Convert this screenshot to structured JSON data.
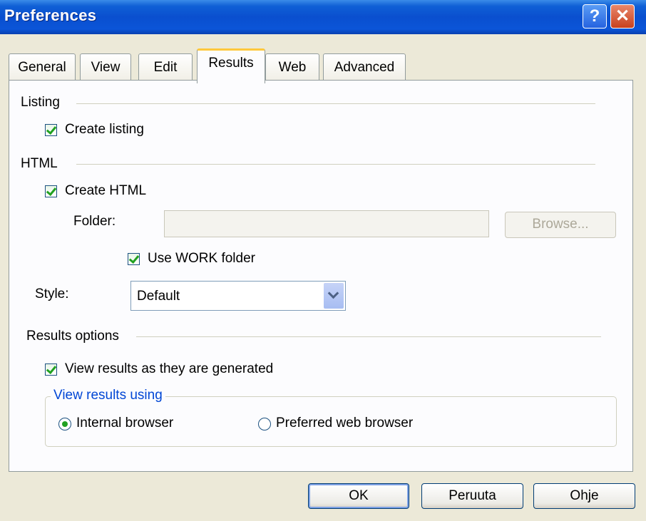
{
  "window": {
    "title": "Preferences"
  },
  "tabs": [
    "General",
    "View",
    "Edit",
    "Results",
    "Web",
    "Advanced"
  ],
  "active_tab": "Results",
  "listing": {
    "section": "Listing",
    "create_listing": {
      "label": "Create listing",
      "checked": true
    }
  },
  "html": {
    "section": "HTML",
    "create_html": {
      "label": "Create HTML",
      "checked": true
    },
    "folder_label": "Folder:",
    "folder_value": "",
    "browse_label": "Browse...",
    "use_work": {
      "label": "Use WORK folder",
      "checked": true
    },
    "style_label": "Style:",
    "style_value": "Default"
  },
  "results_options": {
    "section": "Results options",
    "view_results": {
      "label": "View results as they are generated",
      "checked": true
    },
    "group_title": "View results using",
    "internal": {
      "label": "Internal browser",
      "selected": true
    },
    "preferred": {
      "label": "Preferred web browser",
      "selected": false
    }
  },
  "buttons": {
    "ok": "OK",
    "cancel": "Peruuta",
    "help": "Ohje"
  }
}
